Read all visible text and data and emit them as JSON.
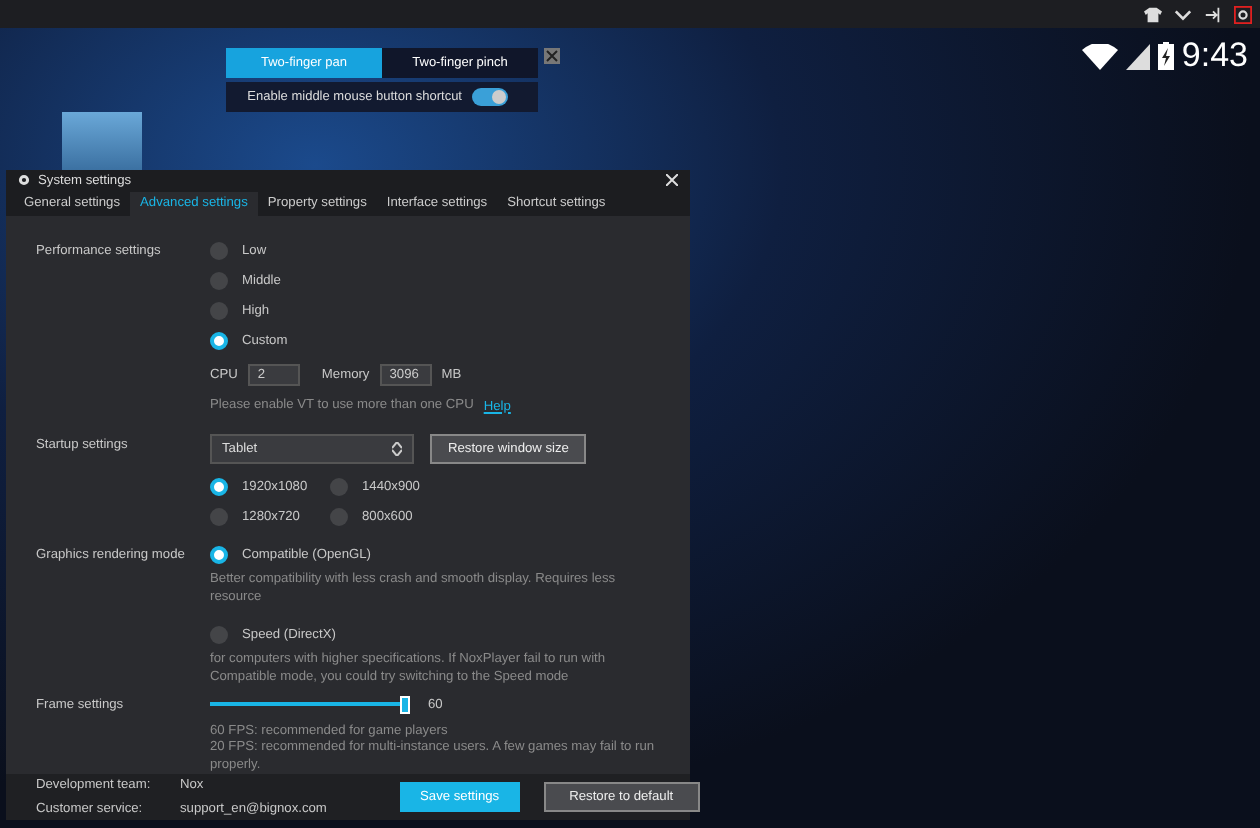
{
  "status_bar": {
    "time": "9:43"
  },
  "gesture_popup": {
    "tabs": [
      {
        "label": "Two-finger pan",
        "selected": true
      },
      {
        "label": "Two-finger pinch",
        "selected": false
      }
    ],
    "shortcut": {
      "label": "Enable middle mouse button shortcut",
      "on": true
    }
  },
  "dialog": {
    "title": "System settings",
    "tabs": [
      {
        "label": "General settings",
        "selected": false
      },
      {
        "label": "Advanced settings",
        "selected": true
      },
      {
        "label": "Property settings",
        "selected": false
      },
      {
        "label": "Interface settings",
        "selected": false
      },
      {
        "label": "Shortcut settings",
        "selected": false
      }
    ],
    "performance": {
      "label": "Performance settings",
      "options": [
        {
          "label": "Low",
          "selected": false
        },
        {
          "label": "Middle",
          "selected": false
        },
        {
          "label": "High",
          "selected": false
        },
        {
          "label": "Custom",
          "selected": true
        }
      ],
      "cpu_label": "CPU",
      "cpu": "2",
      "memory_label": "Memory",
      "memory": "3096",
      "memory_unit": "MB",
      "note": "Please enable VT to use more than one CPU",
      "help": "Help"
    },
    "startup": {
      "label": "Startup settings",
      "mode": "Tablet",
      "restore_button": "Restore window size",
      "resolutions": [
        {
          "label": "1920x1080",
          "selected": true
        },
        {
          "label": "1440x900",
          "selected": false
        },
        {
          "label": "1280x720",
          "selected": false
        },
        {
          "label": "800x600",
          "selected": false
        }
      ]
    },
    "graphics": {
      "label": "Graphics rendering mode",
      "options": [
        {
          "label": "Compatible (OpenGL)",
          "selected": true,
          "description": "Better compatibility with less crash and smooth display. Requires less resource"
        },
        {
          "label": "Speed (DirectX)",
          "selected": false,
          "description": "for computers with higher specifications. If NoxPlayer fail to run with Compatible mode, you could try switching to the Speed mode"
        }
      ]
    },
    "frame": {
      "label": "Frame settings",
      "level": 1,
      "reading": "60",
      "notes": [
        "60 FPS: recommended for game players",
        "20 FPS: recommended for multi-instance users. A few games may fail to run properly."
      ]
    },
    "footer": {
      "team_label": "Development team:",
      "team": "Nox",
      "service_label": "Customer service:",
      "service": "support_en@bignox.com",
      "save_button": "Save settings",
      "default_button": "Restore to default"
    }
  }
}
